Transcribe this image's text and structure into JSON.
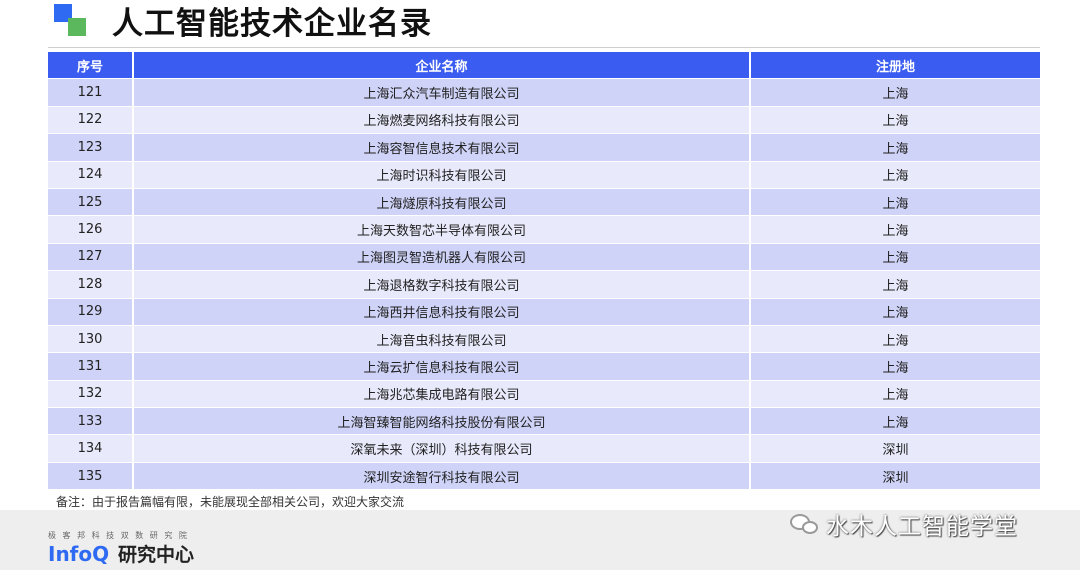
{
  "title": "人工智能技术企业名录",
  "table": {
    "headers": [
      "序号",
      "企业名称",
      "注册地"
    ],
    "rows": [
      [
        "121",
        "上海汇众汽车制造有限公司",
        "上海"
      ],
      [
        "122",
        "上海燃麦网络科技有限公司",
        "上海"
      ],
      [
        "123",
        "上海容智信息技术有限公司",
        "上海"
      ],
      [
        "124",
        "上海时识科技有限公司",
        "上海"
      ],
      [
        "125",
        "上海燧原科技有限公司",
        "上海"
      ],
      [
        "126",
        "上海天数智芯半导体有限公司",
        "上海"
      ],
      [
        "127",
        "上海图灵智造机器人有限公司",
        "上海"
      ],
      [
        "128",
        "上海退格数字科技有限公司",
        "上海"
      ],
      [
        "129",
        "上海西井信息科技有限公司",
        "上海"
      ],
      [
        "130",
        "上海音虫科技有限公司",
        "上海"
      ],
      [
        "131",
        "上海云扩信息科技有限公司",
        "上海"
      ],
      [
        "132",
        "上海兆芯集成电路有限公司",
        "上海"
      ],
      [
        "133",
        "上海智臻智能网络科技股份有限公司",
        "上海"
      ],
      [
        "134",
        "深氧未来（深圳）科技有限公司",
        "深圳"
      ],
      [
        "135",
        "深圳安途智行科技有限公司",
        "深圳"
      ]
    ]
  },
  "note": "备注：由于报告篇幅有限，未能展现全部相关公司，欢迎大家交流",
  "footer": {
    "tagline": "极 客 邦 科 技 双 数 研 究 院",
    "brand": "InfoQ",
    "brand_cn": "研究中心"
  },
  "wechat": {
    "label": "水木人工智能学堂",
    "icon": "wechat-icon"
  },
  "watermark": {
    "brand": "InfoQ研究中心",
    "tagline": "极 客 邦 科 技 双 数 研 究 院"
  },
  "colors": {
    "header": "#3b5cf0",
    "row_odd": "#cfd3f7",
    "row_even": "#e8eafb",
    "accent_blue": "#2f6bf2",
    "accent_green": "#5cb85c"
  }
}
